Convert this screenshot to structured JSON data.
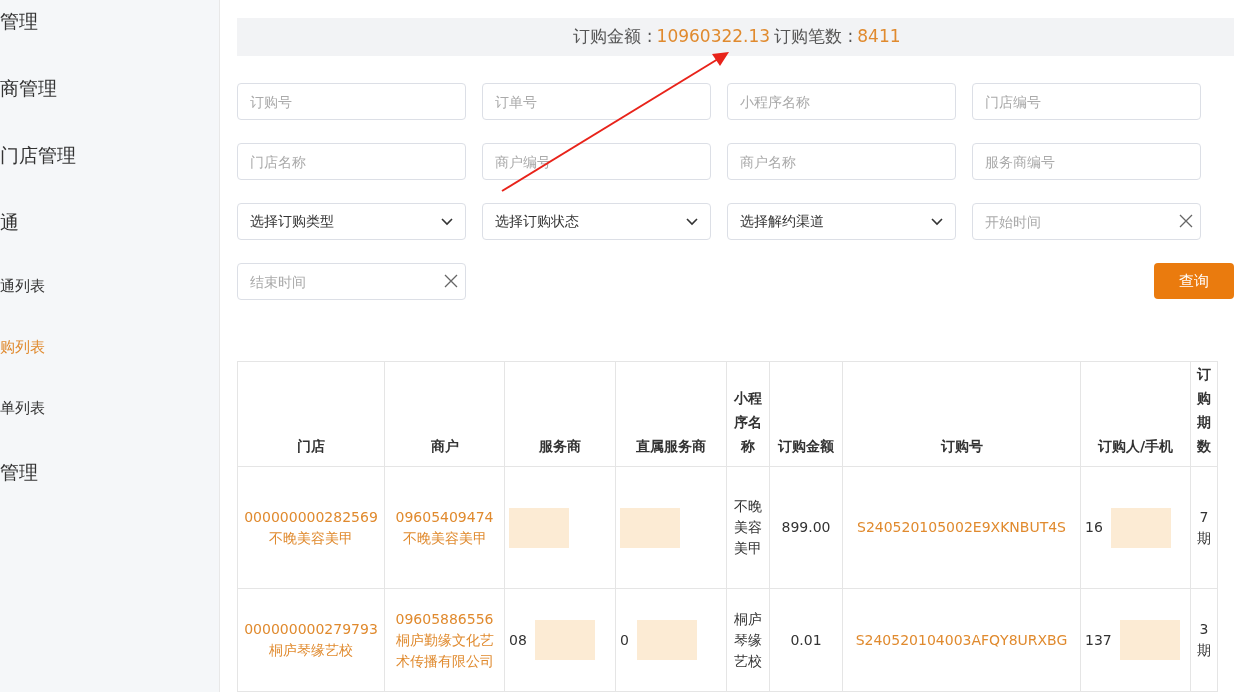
{
  "sidebar": {
    "items": [
      {
        "label": "管理",
        "kind": "group",
        "selected": false
      },
      {
        "label": "商管理",
        "kind": "group",
        "selected": false
      },
      {
        "label": "门店管理",
        "kind": "group",
        "selected": false
      },
      {
        "label": "通",
        "kind": "group",
        "selected": false
      },
      {
        "label": "通列表",
        "kind": "sub",
        "selected": false
      },
      {
        "label": "购列表",
        "kind": "sub",
        "selected": true
      },
      {
        "label": "单列表",
        "kind": "sub",
        "selected": false
      },
      {
        "label": "管理",
        "kind": "group",
        "selected": false
      }
    ]
  },
  "summary": {
    "amount_label": "订购金额 :",
    "amount": "10960322.13",
    "count_label": "订购笔数 :",
    "count": "8411"
  },
  "filters": [
    {
      "kind": "input",
      "placeholder": "订购号"
    },
    {
      "kind": "input",
      "placeholder": "订单号"
    },
    {
      "kind": "input",
      "placeholder": "小程序名称"
    },
    {
      "kind": "input",
      "placeholder": "门店编号"
    },
    {
      "kind": "input",
      "placeholder": "门店名称"
    },
    {
      "kind": "input",
      "placeholder": "商户编号"
    },
    {
      "kind": "input",
      "placeholder": "商户名称"
    },
    {
      "kind": "input",
      "placeholder": "服务商编号"
    },
    {
      "kind": "select",
      "value": "选择订购类型"
    },
    {
      "kind": "select",
      "value": "选择订购状态"
    },
    {
      "kind": "select",
      "value": "选择解约渠道"
    },
    {
      "kind": "date",
      "placeholder": "开始时间"
    },
    {
      "kind": "date",
      "placeholder": "结束时间"
    }
  ],
  "search_button": "查询",
  "table": {
    "columns": [
      "门店",
      "商户",
      "服务商",
      "直属服务商",
      "小程序名称",
      "订购金额",
      "订购号",
      "订购人/手机",
      "订购期数"
    ],
    "rows": [
      [
        {
          "kind": "link",
          "text": "000000000282569\n不晚美容美甲"
        },
        {
          "kind": "link",
          "text": "09605409474\n不晚美容美甲"
        },
        {
          "kind": "blurred"
        },
        {
          "kind": "blurred"
        },
        {
          "kind": "plain",
          "text": "不晚美容美甲"
        },
        {
          "kind": "plain",
          "text": "899.00"
        },
        {
          "kind": "link",
          "text": "S240520105002E9XKNBUT4S"
        },
        {
          "kind": "blurred",
          "text": "16"
        },
        {
          "kind": "plain",
          "text": "7期"
        }
      ],
      [
        {
          "kind": "link",
          "text": "000000000279793\n桐庐琴缘艺校"
        },
        {
          "kind": "link",
          "text": "09605886556\n桐庐勤缘文化艺术传播有限公司"
        },
        {
          "kind": "blurred",
          "text": "08"
        },
        {
          "kind": "blurred",
          "text": "0"
        },
        {
          "kind": "plain",
          "text": "桐庐琴缘艺校"
        },
        {
          "kind": "plain",
          "text": "0.01"
        },
        {
          "kind": "link",
          "text": "S240520104003AFQY8URXBG"
        },
        {
          "kind": "blurred",
          "text": "137"
        },
        {
          "kind": "plain",
          "text": "3期"
        }
      ]
    ]
  }
}
